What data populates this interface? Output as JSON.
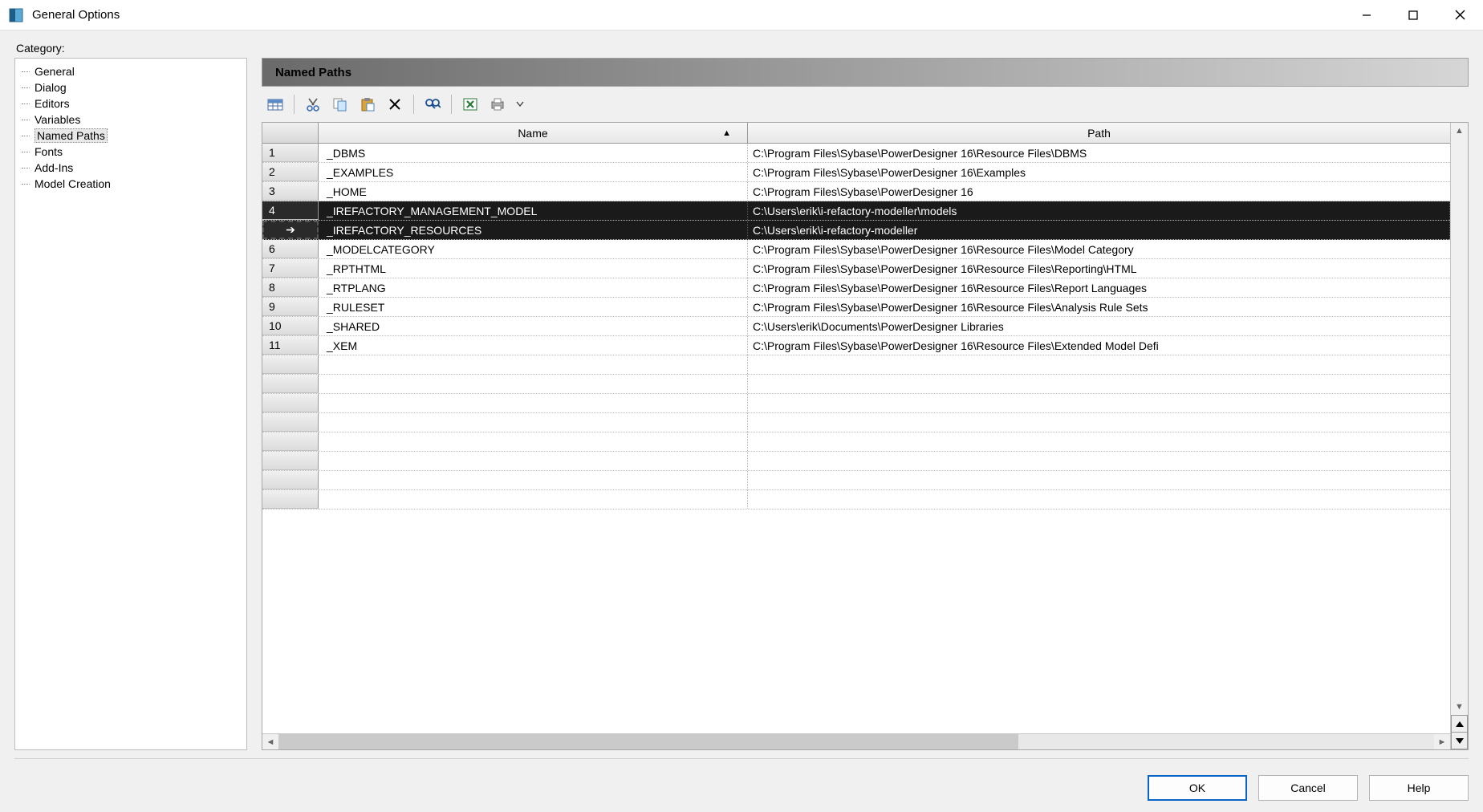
{
  "window": {
    "title": "General Options"
  },
  "category_label": "Category:",
  "panel_title": "Named Paths",
  "tree": {
    "items": [
      {
        "label": "General"
      },
      {
        "label": "Dialog"
      },
      {
        "label": "Editors"
      },
      {
        "label": "Variables"
      },
      {
        "label": "Named Paths",
        "selected": true
      },
      {
        "label": "Fonts"
      },
      {
        "label": "Add-Ins"
      },
      {
        "label": "Model Creation"
      }
    ]
  },
  "grid": {
    "headers": {
      "name": "Name",
      "path": "Path"
    },
    "rows": [
      {
        "num": "1",
        "name": "_DBMS",
        "path": "C:\\Program Files\\Sybase\\PowerDesigner 16\\Resource Files\\DBMS"
      },
      {
        "num": "2",
        "name": "_EXAMPLES",
        "path": "C:\\Program Files\\Sybase\\PowerDesigner 16\\Examples"
      },
      {
        "num": "3",
        "name": "_HOME",
        "path": "C:\\Program Files\\Sybase\\PowerDesigner 16"
      },
      {
        "num": "4",
        "name": "_IREFACTORY_MANAGEMENT_MODEL",
        "path": "C:\\Users\\erik\\i-refactory-modeller\\models",
        "selected": true
      },
      {
        "num": "➔",
        "name": "_IREFACTORY_RESOURCES",
        "path": "C:\\Users\\erik\\i-refactory-modeller",
        "selected": true,
        "current": true
      },
      {
        "num": "6",
        "name": "_MODELCATEGORY",
        "path": "C:\\Program Files\\Sybase\\PowerDesigner 16\\Resource Files\\Model Category"
      },
      {
        "num": "7",
        "name": "_RPTHTML",
        "path": "C:\\Program Files\\Sybase\\PowerDesigner 16\\Resource Files\\Reporting\\HTML"
      },
      {
        "num": "8",
        "name": "_RTPLANG",
        "path": "C:\\Program Files\\Sybase\\PowerDesigner 16\\Resource Files\\Report Languages"
      },
      {
        "num": "9",
        "name": "_RULESET",
        "path": "C:\\Program Files\\Sybase\\PowerDesigner 16\\Resource Files\\Analysis Rule Sets"
      },
      {
        "num": "10",
        "name": "_SHARED",
        "path": "C:\\Users\\erik\\Documents\\PowerDesigner Libraries"
      },
      {
        "num": "11",
        "name": "_XEM",
        "path": "C:\\Program Files\\Sybase\\PowerDesigner 16\\Resource Files\\Extended Model Defi"
      }
    ],
    "empty_rows": 8
  },
  "buttons": {
    "ok": "OK",
    "cancel": "Cancel",
    "help": "Help"
  },
  "toolbar_icons": [
    "grid-icon",
    "cut-icon",
    "copy-icon",
    "paste-icon",
    "delete-icon",
    "find-icon",
    "excel-icon",
    "print-icon"
  ]
}
